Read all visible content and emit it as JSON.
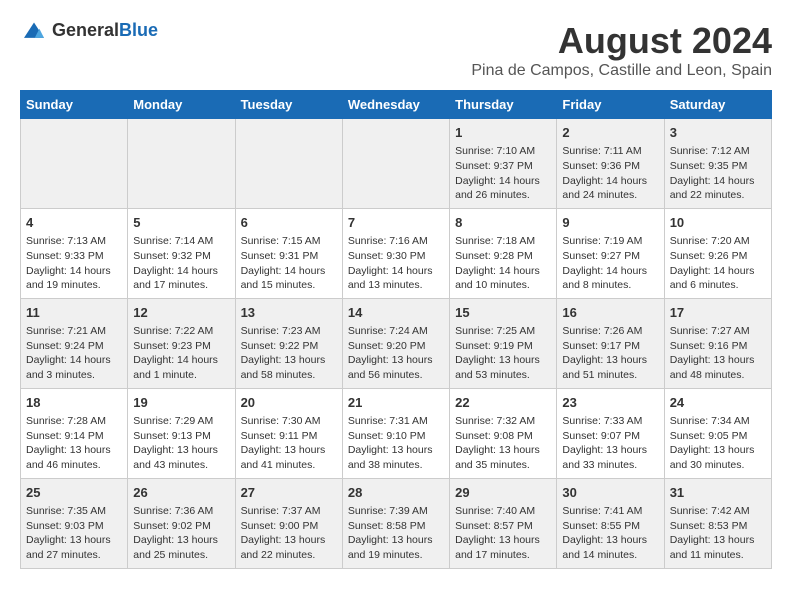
{
  "header": {
    "logo_general": "General",
    "logo_blue": "Blue",
    "title": "August 2024",
    "subtitle": "Pina de Campos, Castille and Leon, Spain"
  },
  "days_of_week": [
    "Sunday",
    "Monday",
    "Tuesday",
    "Wednesday",
    "Thursday",
    "Friday",
    "Saturday"
  ],
  "weeks": [
    [
      {
        "day": "",
        "info": ""
      },
      {
        "day": "",
        "info": ""
      },
      {
        "day": "",
        "info": ""
      },
      {
        "day": "",
        "info": ""
      },
      {
        "day": "1",
        "info": "Sunrise: 7:10 AM\nSunset: 9:37 PM\nDaylight: 14 hours\nand 26 minutes."
      },
      {
        "day": "2",
        "info": "Sunrise: 7:11 AM\nSunset: 9:36 PM\nDaylight: 14 hours\nand 24 minutes."
      },
      {
        "day": "3",
        "info": "Sunrise: 7:12 AM\nSunset: 9:35 PM\nDaylight: 14 hours\nand 22 minutes."
      }
    ],
    [
      {
        "day": "4",
        "info": "Sunrise: 7:13 AM\nSunset: 9:33 PM\nDaylight: 14 hours\nand 19 minutes."
      },
      {
        "day": "5",
        "info": "Sunrise: 7:14 AM\nSunset: 9:32 PM\nDaylight: 14 hours\nand 17 minutes."
      },
      {
        "day": "6",
        "info": "Sunrise: 7:15 AM\nSunset: 9:31 PM\nDaylight: 14 hours\nand 15 minutes."
      },
      {
        "day": "7",
        "info": "Sunrise: 7:16 AM\nSunset: 9:30 PM\nDaylight: 14 hours\nand 13 minutes."
      },
      {
        "day": "8",
        "info": "Sunrise: 7:18 AM\nSunset: 9:28 PM\nDaylight: 14 hours\nand 10 minutes."
      },
      {
        "day": "9",
        "info": "Sunrise: 7:19 AM\nSunset: 9:27 PM\nDaylight: 14 hours\nand 8 minutes."
      },
      {
        "day": "10",
        "info": "Sunrise: 7:20 AM\nSunset: 9:26 PM\nDaylight: 14 hours\nand 6 minutes."
      }
    ],
    [
      {
        "day": "11",
        "info": "Sunrise: 7:21 AM\nSunset: 9:24 PM\nDaylight: 14 hours\nand 3 minutes."
      },
      {
        "day": "12",
        "info": "Sunrise: 7:22 AM\nSunset: 9:23 PM\nDaylight: 14 hours\nand 1 minute."
      },
      {
        "day": "13",
        "info": "Sunrise: 7:23 AM\nSunset: 9:22 PM\nDaylight: 13 hours\nand 58 minutes."
      },
      {
        "day": "14",
        "info": "Sunrise: 7:24 AM\nSunset: 9:20 PM\nDaylight: 13 hours\nand 56 minutes."
      },
      {
        "day": "15",
        "info": "Sunrise: 7:25 AM\nSunset: 9:19 PM\nDaylight: 13 hours\nand 53 minutes."
      },
      {
        "day": "16",
        "info": "Sunrise: 7:26 AM\nSunset: 9:17 PM\nDaylight: 13 hours\nand 51 minutes."
      },
      {
        "day": "17",
        "info": "Sunrise: 7:27 AM\nSunset: 9:16 PM\nDaylight: 13 hours\nand 48 minutes."
      }
    ],
    [
      {
        "day": "18",
        "info": "Sunrise: 7:28 AM\nSunset: 9:14 PM\nDaylight: 13 hours\nand 46 minutes."
      },
      {
        "day": "19",
        "info": "Sunrise: 7:29 AM\nSunset: 9:13 PM\nDaylight: 13 hours\nand 43 minutes."
      },
      {
        "day": "20",
        "info": "Sunrise: 7:30 AM\nSunset: 9:11 PM\nDaylight: 13 hours\nand 41 minutes."
      },
      {
        "day": "21",
        "info": "Sunrise: 7:31 AM\nSunset: 9:10 PM\nDaylight: 13 hours\nand 38 minutes."
      },
      {
        "day": "22",
        "info": "Sunrise: 7:32 AM\nSunset: 9:08 PM\nDaylight: 13 hours\nand 35 minutes."
      },
      {
        "day": "23",
        "info": "Sunrise: 7:33 AM\nSunset: 9:07 PM\nDaylight: 13 hours\nand 33 minutes."
      },
      {
        "day": "24",
        "info": "Sunrise: 7:34 AM\nSunset: 9:05 PM\nDaylight: 13 hours\nand 30 minutes."
      }
    ],
    [
      {
        "day": "25",
        "info": "Sunrise: 7:35 AM\nSunset: 9:03 PM\nDaylight: 13 hours\nand 27 minutes."
      },
      {
        "day": "26",
        "info": "Sunrise: 7:36 AM\nSunset: 9:02 PM\nDaylight: 13 hours\nand 25 minutes."
      },
      {
        "day": "27",
        "info": "Sunrise: 7:37 AM\nSunset: 9:00 PM\nDaylight: 13 hours\nand 22 minutes."
      },
      {
        "day": "28",
        "info": "Sunrise: 7:39 AM\nSunset: 8:58 PM\nDaylight: 13 hours\nand 19 minutes."
      },
      {
        "day": "29",
        "info": "Sunrise: 7:40 AM\nSunset: 8:57 PM\nDaylight: 13 hours\nand 17 minutes."
      },
      {
        "day": "30",
        "info": "Sunrise: 7:41 AM\nSunset: 8:55 PM\nDaylight: 13 hours\nand 14 minutes."
      },
      {
        "day": "31",
        "info": "Sunrise: 7:42 AM\nSunset: 8:53 PM\nDaylight: 13 hours\nand 11 minutes."
      }
    ]
  ]
}
